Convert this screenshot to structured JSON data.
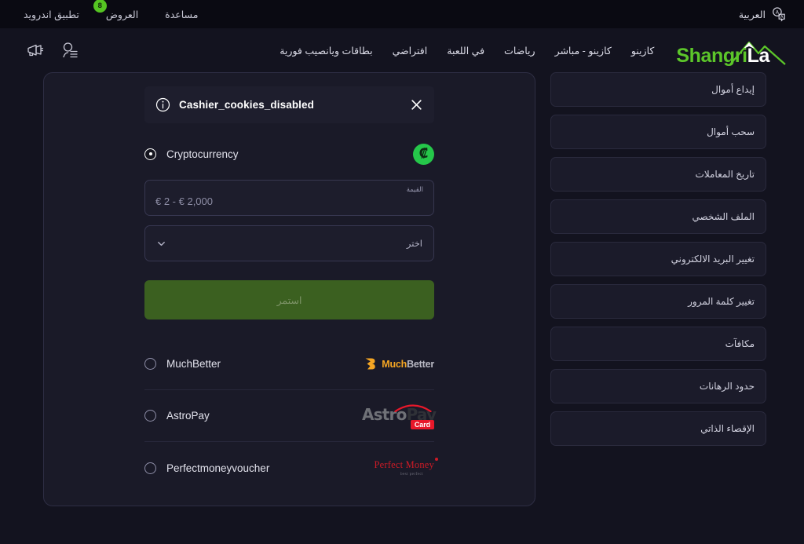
{
  "topbar": {
    "language": "العربية",
    "language_icon": "translate-icon",
    "links": [
      {
        "label": "مساعدة",
        "badge": null
      },
      {
        "label": "العروض",
        "badge": "8"
      },
      {
        "label": "تطبيق اندرويد",
        "badge": null
      }
    ]
  },
  "header": {
    "logo": {
      "green": "Shangri",
      "white": "La"
    },
    "nav": [
      {
        "label": "كازينو"
      },
      {
        "label": "كازينو - مباشر"
      },
      {
        "label": "رياضات"
      },
      {
        "label": "في اللعبة"
      },
      {
        "label": "افتراضي"
      },
      {
        "label": "بطاقات ويانصيب فورية"
      }
    ],
    "icons": [
      {
        "name": "megaphone-icon"
      },
      {
        "name": "account-icon"
      }
    ]
  },
  "sidebar": {
    "items": [
      {
        "label": "إيداع أموال"
      },
      {
        "label": "سحب أموال"
      },
      {
        "label": "تاريخ المعاملات"
      },
      {
        "label": "الملف الشخصي"
      },
      {
        "label": "تغيير البريد الالكتروني"
      },
      {
        "label": "تغيير كلمة المرور"
      },
      {
        "label": "مكافآت"
      },
      {
        "label": "حدود الرهانات"
      },
      {
        "label": "الإقصاء الذاتي"
      }
    ]
  },
  "cashier": {
    "alert": {
      "icon": "info-icon",
      "title": "Cashier_cookies_disabled",
      "close_icon": "close-icon"
    },
    "selected_method": "Cryptocurrency",
    "crypto": {
      "label": "Cryptocurrency",
      "logo_glyph": "₡"
    },
    "amount_field": {
      "label": "القيمة",
      "placeholder": "€ 2 - € 2,000",
      "value": ""
    },
    "currency_select": {
      "value": "اختر",
      "chevron_icon": "chevron-down-icon"
    },
    "submit_label": "استمر",
    "methods": [
      {
        "label": "MuchBetter",
        "logo_type": "muchbetter",
        "logo_text_primary": "Much",
        "logo_text_secondary": "Better"
      },
      {
        "label": "AstroPay",
        "logo_type": "astropay",
        "logo_text_primary": "Astro",
        "logo_text_secondary": "Pay",
        "logo_badge": "Card"
      },
      {
        "label": "Perfectmoneyvoucher",
        "logo_type": "perfectmoney",
        "logo_text_primary": "Perfect Money",
        "logo_text_secondary": "best perfect"
      }
    ]
  },
  "colors": {
    "page_bg": "#13131f",
    "topbar_bg": "#0a0a12",
    "card_bg": "#1a1a28",
    "accent_green": "#5cc62a",
    "submit_green": "#3b6020",
    "badge_green": "#55c422"
  }
}
